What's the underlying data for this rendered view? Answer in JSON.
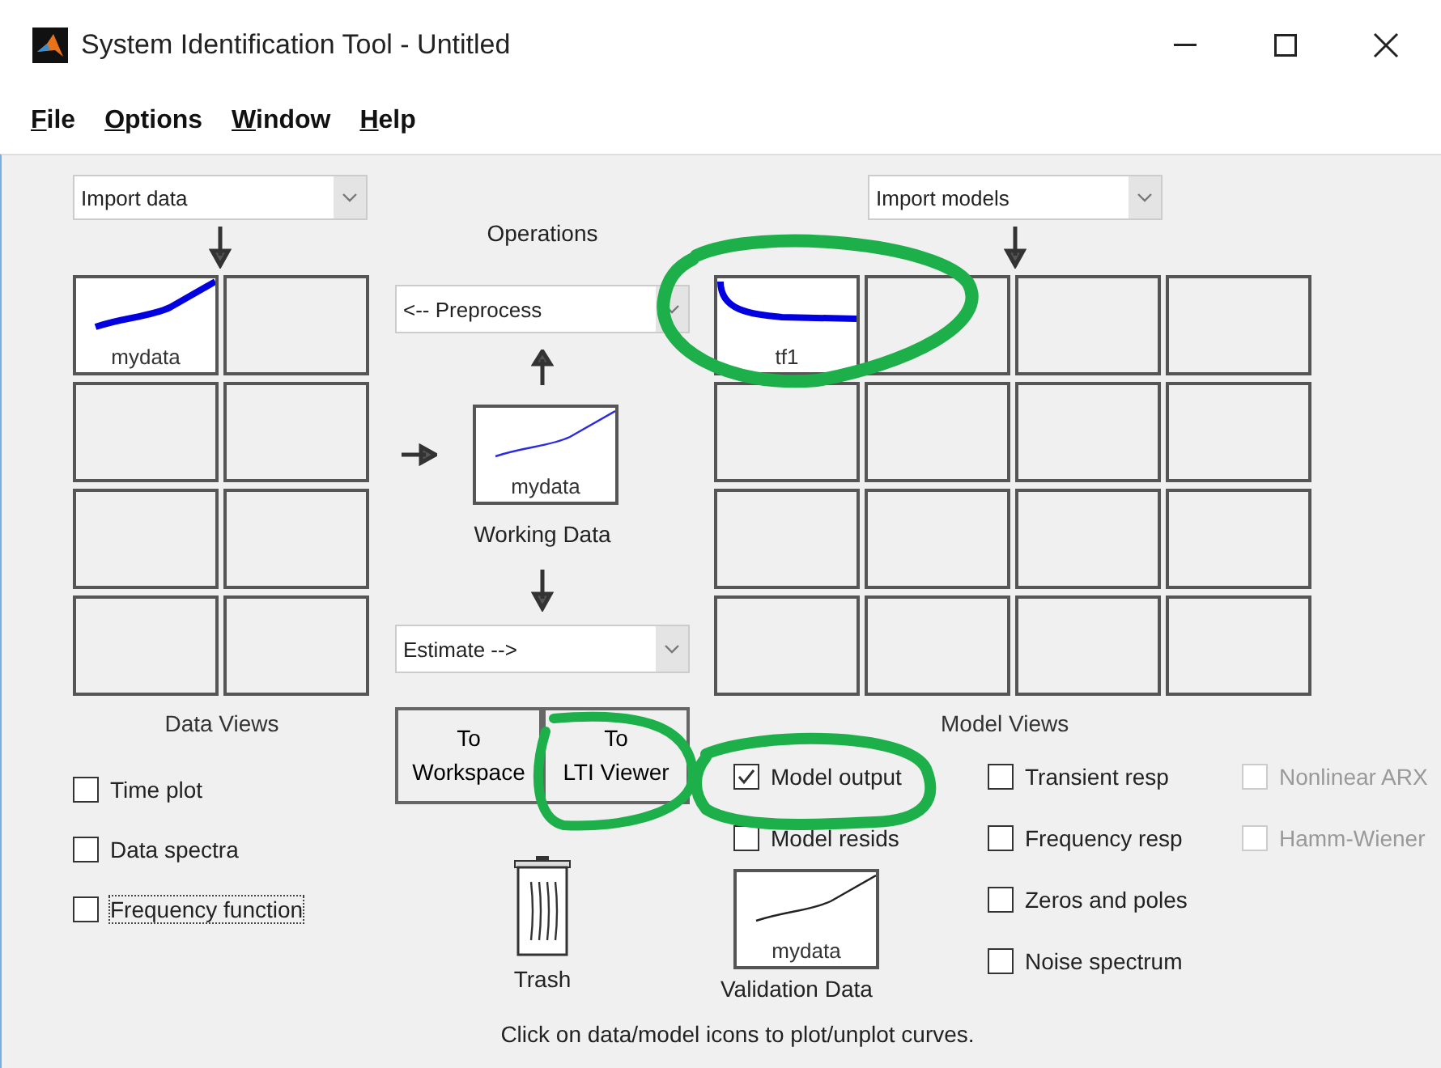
{
  "window": {
    "title": "System Identification Tool - Untitled"
  },
  "menu": [
    {
      "label": "File"
    },
    {
      "label": "Options"
    },
    {
      "label": "Window"
    },
    {
      "label": "Help"
    }
  ],
  "data_board": {
    "import_dropdown": "Import data",
    "tiles": [
      {
        "kind": "data",
        "label": "mydata"
      },
      {
        "kind": "empty"
      },
      {
        "kind": "empty"
      },
      {
        "kind": "empty"
      },
      {
        "kind": "empty"
      },
      {
        "kind": "empty"
      },
      {
        "kind": "empty"
      },
      {
        "kind": "empty"
      }
    ]
  },
  "operations": {
    "title": "Operations",
    "preprocess": "<-- Preprocess",
    "working_data": {
      "label": "mydata",
      "caption": "Working Data"
    },
    "estimate": "Estimate -->"
  },
  "model_board": {
    "import_dropdown": "Import models",
    "tiles": [
      {
        "kind": "model",
        "label": "tf1"
      },
      {
        "kind": "empty"
      },
      {
        "kind": "empty"
      },
      {
        "kind": "empty"
      },
      {
        "kind": "empty"
      },
      {
        "kind": "empty"
      },
      {
        "kind": "empty"
      },
      {
        "kind": "empty"
      },
      {
        "kind": "empty"
      },
      {
        "kind": "empty"
      },
      {
        "kind": "empty"
      },
      {
        "kind": "empty"
      },
      {
        "kind": "empty"
      },
      {
        "kind": "empty"
      },
      {
        "kind": "empty"
      },
      {
        "kind": "empty"
      }
    ]
  },
  "data_views": {
    "title": "Data Views",
    "options": [
      {
        "label": "Time plot",
        "checked": false,
        "focused": false
      },
      {
        "label": "Data spectra",
        "checked": false,
        "focused": false
      },
      {
        "label": "Frequency function",
        "checked": false,
        "focused": true
      }
    ]
  },
  "export_buttons": [
    {
      "lines": [
        "To",
        "Workspace"
      ]
    },
    {
      "lines": [
        "To",
        "LTI Viewer"
      ]
    }
  ],
  "trash": {
    "label": "Trash"
  },
  "model_views": {
    "title": "Model Views",
    "columns": [
      [
        {
          "label": "Model output",
          "checked": true,
          "disabled": false
        },
        {
          "label": "Model resids",
          "checked": false,
          "disabled": false
        }
      ],
      [
        {
          "label": "Transient resp",
          "checked": false,
          "disabled": false
        },
        {
          "label": "Frequency resp",
          "checked": false,
          "disabled": false
        },
        {
          "label": "Zeros and poles",
          "checked": false,
          "disabled": false
        },
        {
          "label": "Noise spectrum",
          "checked": false,
          "disabled": false
        }
      ],
      [
        {
          "label": "Nonlinear ARX",
          "checked": false,
          "disabled": true
        },
        {
          "label": "Hamm-Wiener",
          "checked": false,
          "disabled": true
        }
      ]
    ]
  },
  "validation_data": {
    "label": "mydata",
    "caption": "Validation Data"
  },
  "hint": "Click on data/model icons to plot/unplot curves."
}
